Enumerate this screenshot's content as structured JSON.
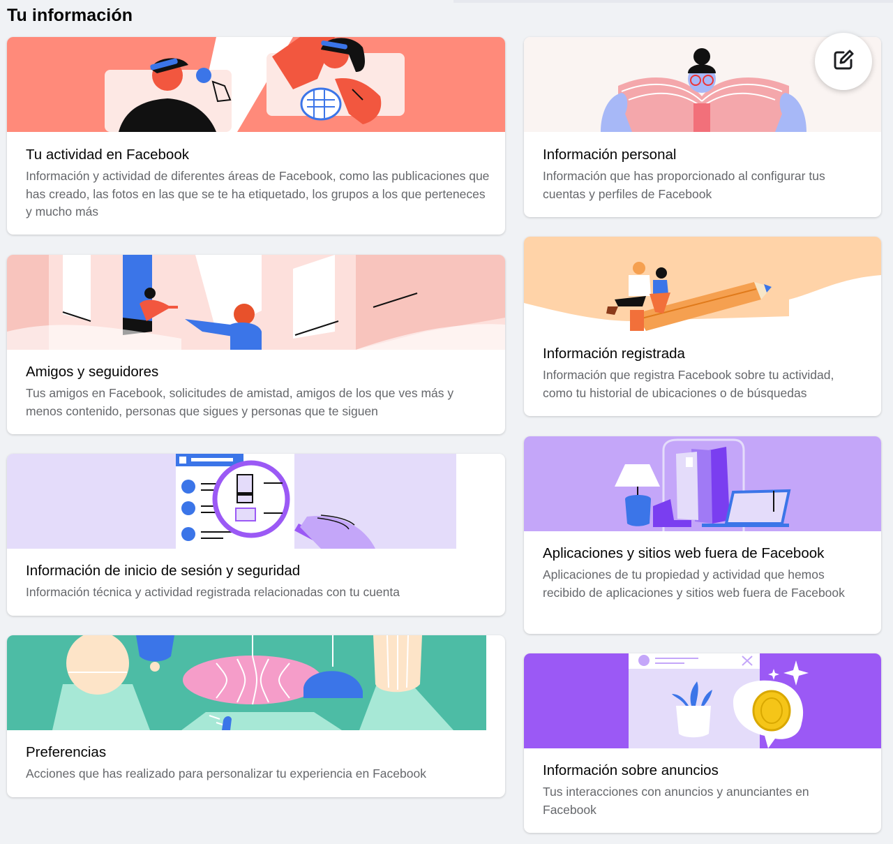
{
  "page": {
    "title": "Tu información"
  },
  "cards": {
    "activity": {
      "title": "Tu actividad en Facebook",
      "description": "Información y actividad de diferentes áreas de Facebook, como las publicaciones que has creado, las fotos en las que se te ha etiquetado, los grupos a los que perteneces y mucho más"
    },
    "personal": {
      "title": "Información personal",
      "description": "Información que has proporcionado al configurar tus cuentas y perfiles de Facebook"
    },
    "friends": {
      "title": "Amigos y seguidores",
      "description": "Tus amigos en Facebook, solicitudes de amistad, amigos de los que ves más y menos contenido, personas que sigues y personas que te siguen"
    },
    "logged": {
      "title": "Información registrada",
      "description": "Información que registra Facebook sobre tu actividad, como tu historial de ubicaciones o de búsquedas"
    },
    "login": {
      "title": "Información de inicio de sesión y seguridad",
      "description": "Información técnica y actividad registrada relacionadas con tu cuenta"
    },
    "offsite": {
      "title": "Aplicaciones y sitios web fuera de Facebook",
      "description": "Aplicaciones de tu propiedad y actividad que hemos recibido de aplicaciones y sitios web fuera de Facebook"
    },
    "preferences": {
      "title": "Preferencias",
      "description": "Acciones que has realizado para personalizar tu experiencia en Facebook"
    },
    "ads": {
      "title": "Información sobre anuncios",
      "description": "Tus interacciones con anuncios y anunciantes en Facebook"
    }
  },
  "icons": {
    "edit": "compose-edit-icon"
  },
  "colors": {
    "activity": "#ff8a7a",
    "personal": "#f4a7ab",
    "friends": "#f8c4bd",
    "logged": "#ffd3a8",
    "login": "#e4dcfa",
    "offsite": "#c4a6f9",
    "preferences": "#4dbca5",
    "ads": "#9b59f5"
  }
}
